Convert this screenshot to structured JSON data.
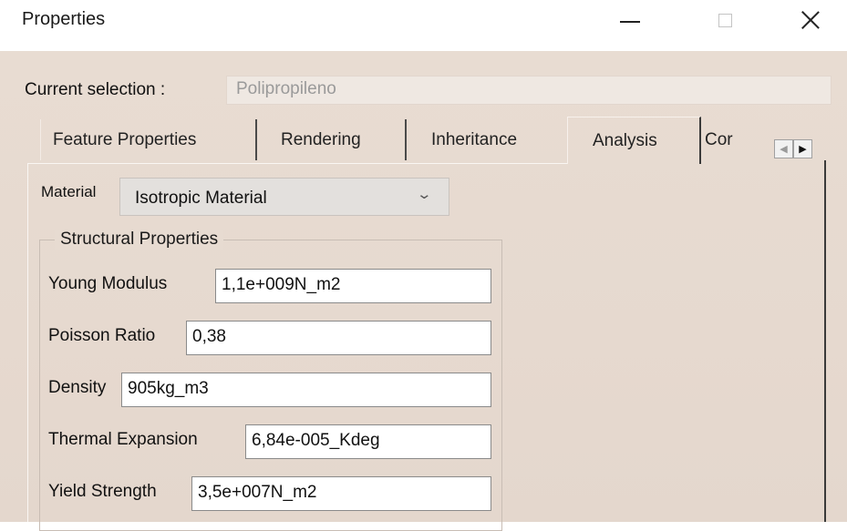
{
  "window": {
    "title": "Properties"
  },
  "current_selection": {
    "label": "Current selection :",
    "value": "Polipropileno"
  },
  "tabs": [
    {
      "label": "Feature Properties"
    },
    {
      "label": "Rendering"
    },
    {
      "label": "Inheritance"
    },
    {
      "label": "Analysis",
      "selected": true
    },
    {
      "label": "Cor"
    }
  ],
  "analysis": {
    "material_label": "Material",
    "material_value": "Isotropic Material",
    "group_title": "Structural Properties",
    "fields": [
      {
        "label": "Young Modulus",
        "value": "1,1e+009N_m2"
      },
      {
        "label": "Poisson Ratio",
        "value": "0,38"
      },
      {
        "label": "Density",
        "value": "905kg_m3"
      },
      {
        "label": "Thermal Expansion",
        "value": "6,84e-005_Kdeg"
      },
      {
        "label": "Yield Strength",
        "value": "3,5e+007N_m2"
      }
    ]
  }
}
